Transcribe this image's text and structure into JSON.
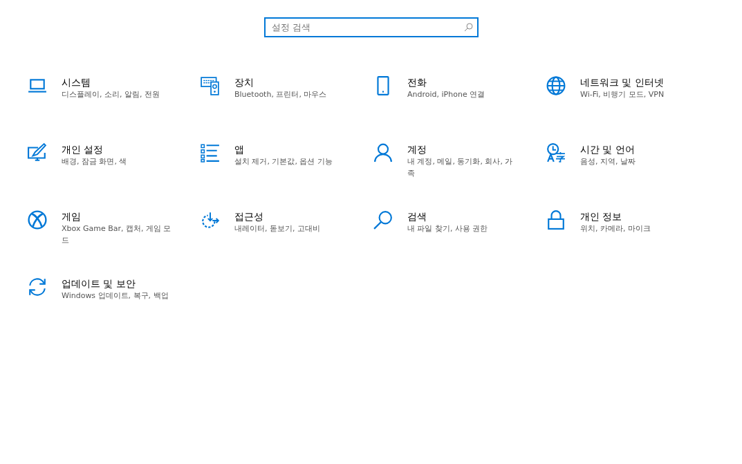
{
  "search": {
    "placeholder": "설정 검색"
  },
  "categories": [
    {
      "title": "시스템",
      "subtitle": "디스플레이, 소리, 알림, 전원"
    },
    {
      "title": "장치",
      "subtitle": "Bluetooth, 프린터, 마우스"
    },
    {
      "title": "전화",
      "subtitle": "Android, iPhone 연결"
    },
    {
      "title": "네트워크 및 인터넷",
      "subtitle": "Wi-Fi, 비행기 모드, VPN"
    },
    {
      "title": "개인 설정",
      "subtitle": "배경, 잠금 화면, 색"
    },
    {
      "title": "앱",
      "subtitle": "설치 제거, 기본값, 옵션 기능"
    },
    {
      "title": "계정",
      "subtitle": "내 계정, 메일, 동기화, 회사, 가족"
    },
    {
      "title": "시간 및 언어",
      "subtitle": "음성, 지역, 날짜"
    },
    {
      "title": "게임",
      "subtitle": "Xbox Game Bar, 캡처, 게임 모드"
    },
    {
      "title": "접근성",
      "subtitle": "내레이터, 돋보기, 고대비"
    },
    {
      "title": "검색",
      "subtitle": "내 파일 찾기, 사용 권한"
    },
    {
      "title": "개인 정보",
      "subtitle": "위치, 카메라, 마이크"
    },
    {
      "title": "업데이트 및 보안",
      "subtitle": "Windows 업데이트, 복구, 백업"
    }
  ]
}
